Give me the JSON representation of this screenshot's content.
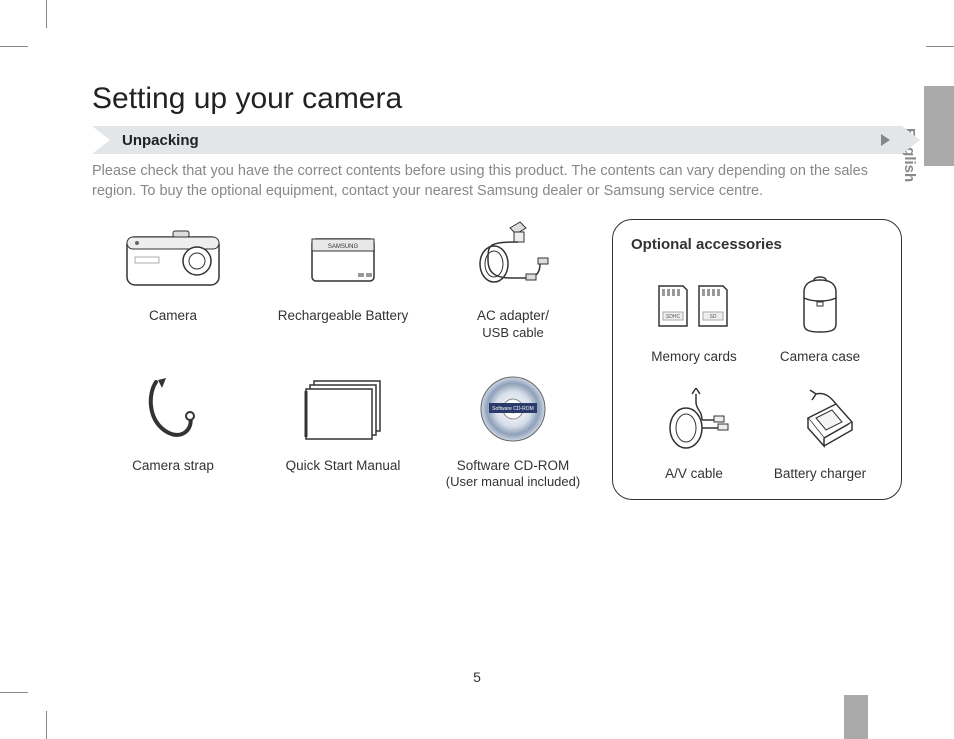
{
  "title": "Setting up your camera",
  "section": {
    "label": "Unpacking"
  },
  "intro": "Please check that you have the correct contents before using this product. The contents can vary depending on the sales region. To buy the optional equipment, contact your nearest Samsung dealer or Samsung service centre.",
  "included": [
    {
      "label": "Camera"
    },
    {
      "label": "Rechargeable Battery"
    },
    {
      "label": "AC adapter/",
      "sub": "USB cable"
    },
    {
      "label": "Camera strap"
    },
    {
      "label": "Quick Start Manual"
    },
    {
      "label": "Software CD-ROM",
      "sub": "(User manual included)"
    }
  ],
  "optional": {
    "title": "Optional accessories",
    "items": [
      {
        "label": "Memory cards"
      },
      {
        "label": "Camera case"
      },
      {
        "label": "A/V cable"
      },
      {
        "label": "Battery charger"
      }
    ]
  },
  "side_language": "English",
  "page_number": "5",
  "cd_text": "Software CD-ROM",
  "sd_labels": {
    "sdhc": "SDHC",
    "sd": "SD"
  },
  "battery_brand": "SAMSUNG"
}
